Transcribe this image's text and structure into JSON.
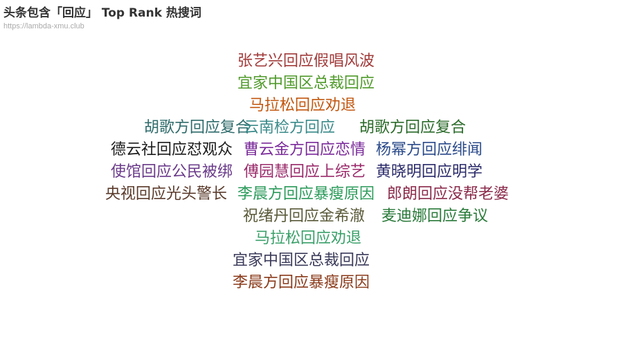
{
  "title": "头条包含「回应」 Top Rank 热搜词",
  "subtitle": "https://lambda-xmu.club",
  "chart_data": {
    "type": "wordcloud",
    "words": [
      {
        "text": "张艺兴回应假唱风波",
        "color": "#a23b3b"
      },
      {
        "text": "宜家中国区总裁回应",
        "color": "#4f9a2a"
      },
      {
        "text": "马拉松回应劝退",
        "color": "#c2570f"
      },
      {
        "text": "胡歌方回应复合",
        "color": "#2f6b6b"
      },
      {
        "text": "云南检方回应",
        "color": "#3a8a8a"
      },
      {
        "text": "胡歌方回应复合",
        "color": "#2a6a2a"
      },
      {
        "text": "德云社回应怼观众",
        "color": "#1a1a1a"
      },
      {
        "text": "曹云金方回应恋情",
        "color": "#7a2a9a"
      },
      {
        "text": "杨幂方回应绯闻",
        "color": "#2a4a8a"
      },
      {
        "text": "使馆回应公民被绑",
        "color": "#6a3a8a"
      },
      {
        "text": "傅园慧回应上综艺",
        "color": "#9a2a6a"
      },
      {
        "text": "黄晓明回应明学",
        "color": "#2a2a6a"
      },
      {
        "text": "央视回应光头警长",
        "color": "#5a3a2a"
      },
      {
        "text": "李晨方回应暴瘦原因",
        "color": "#2a9a5a"
      },
      {
        "text": "郎朗回应没帮老婆",
        "color": "#8a2a4a"
      },
      {
        "text": "祝绪丹回应金希澈",
        "color": "#5a5a3a"
      },
      {
        "text": "麦迪娜回应争议",
        "color": "#2a7a3a"
      },
      {
        "text": "马拉松回应劝退",
        "color": "#3aa06a"
      },
      {
        "text": "宜家中国区总裁回应",
        "color": "#3a3a5a"
      },
      {
        "text": "李晨方回应暴瘦原因",
        "color": "#8a3a1a"
      }
    ]
  }
}
